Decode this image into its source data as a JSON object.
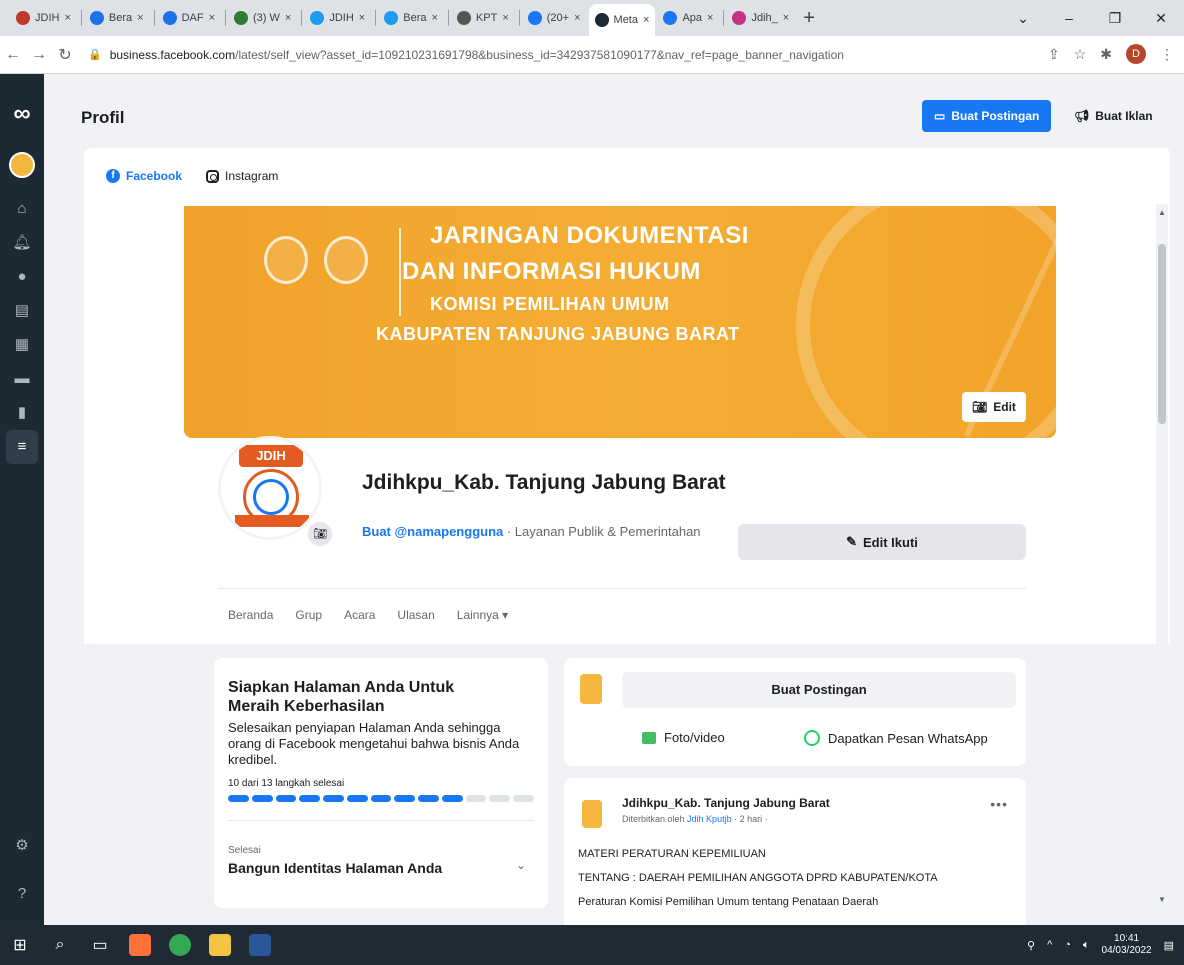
{
  "browser": {
    "tabs": [
      {
        "label": "JDIH",
        "color": "#c0392b"
      },
      {
        "label": "Bera",
        "color": "#1a73e8"
      },
      {
        "label": "DAF",
        "color": "#1a73e8"
      },
      {
        "label": "(3) W",
        "color": "#2e7d32"
      },
      {
        "label": "JDIH",
        "color": "#1d9bf0"
      },
      {
        "label": "Bera",
        "color": "#1d9bf0"
      },
      {
        "label": "KPT",
        "color": "#555555"
      },
      {
        "label": "(20+",
        "color": "#1877f2"
      },
      {
        "label": "Meta",
        "color": "#1c2b33",
        "active": true
      },
      {
        "label": "Apa",
        "color": "#1877f2"
      },
      {
        "label": "Jdih_",
        "color": "#c13584"
      }
    ],
    "url_host": "business.facebook.com",
    "url_path": "/latest/self_view?asset_id=109210231691798&business_id=342937581090177&nav_ref=page_banner_navigation",
    "profile_initial": "D"
  },
  "header": {
    "title": "Profil",
    "create_post_label": "Buat Postingan",
    "create_ad_label": "Buat Iklan"
  },
  "platform_tabs": {
    "facebook": "Facebook",
    "instagram": "Instagram"
  },
  "cover": {
    "line1": "JARINGAN DOKUMENTASI",
    "line2": "DAN INFORMASI HUKUM",
    "line3": "KOMISI PEMILIHAN UMUM",
    "line4": "KABUPATEN TANJUNG JABUNG BARAT",
    "edit_label": "Edit"
  },
  "page": {
    "avatar_text": "JDIH",
    "name": "Jdihkpu_Kab. Tanjung Jabung Barat",
    "username_cta": "Buat @namapengguna",
    "category": " · Layanan Publik & Pemerintahan",
    "edit_follow_label": "Edit Ikuti",
    "nav": [
      "Beranda",
      "Grup",
      "Acara",
      "Ulasan",
      "Lainnya ▾"
    ]
  },
  "setup_card": {
    "title": "Siapkan Halaman Anda Untuk Meraih Keberhasilan",
    "description": "Selesaikan penyiapan Halaman Anda sehingga orang di Facebook mengetahui bahwa bisnis Anda kredibel.",
    "progress_label": "10 dari 13 langkah selesai",
    "steps_done": 10,
    "steps_total": 13,
    "section_label": "Selesai",
    "section_item": "Bangun Identitas Halaman Anda"
  },
  "composer": {
    "create_post_label": "Buat Postingan",
    "photo_label": "Foto/video",
    "whatsapp_label": "Dapatkan Pesan WhatsApp"
  },
  "post": {
    "author": "Jdihkpu_Kab. Tanjung Jabung Barat",
    "meta_prefix": "Diterbitkan oleh ",
    "meta_by": "Jdih Kputjb",
    "meta_suffix": " · 2 hari ·",
    "lines": [
      "MATERI PERATURAN KEPEMILIUAN",
      "TENTANG : DAERAH PEMILIHAN ANGGOTA DPRD KABUPATEN/KOTA",
      "Peraturan Komisi Pemilihan Umum tentang Penataan Daerah"
    ]
  },
  "taskbar": {
    "time": "10:41",
    "date": "04/03/2022"
  }
}
